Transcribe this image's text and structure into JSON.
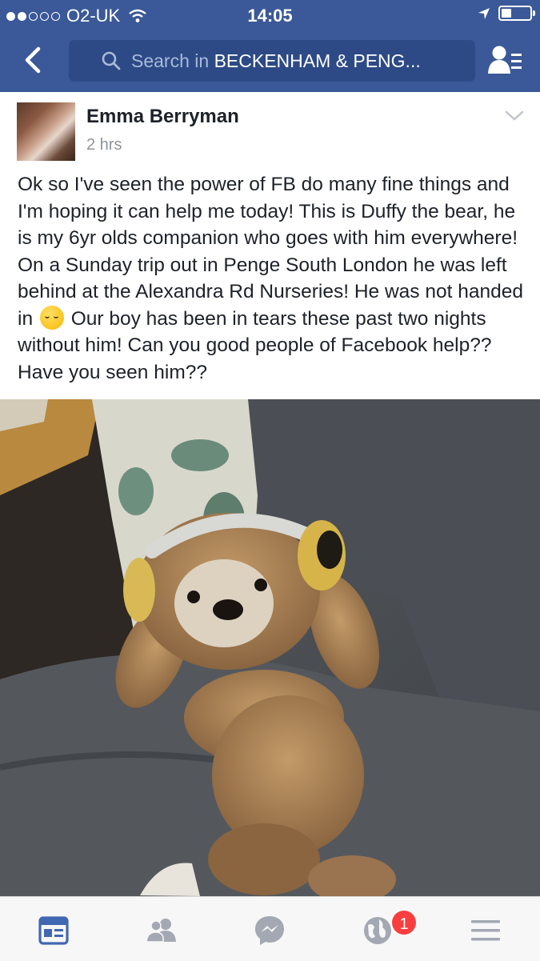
{
  "status_bar": {
    "carrier": "O2-UK",
    "time": "14:05",
    "battery_fraction": 0.35
  },
  "nav": {
    "search_prefix": "Search in ",
    "search_group": "BECKENHAM & PENG..."
  },
  "post": {
    "author": "Emma Berryman",
    "timestamp": "2 hrs",
    "text_before_emoji": "Ok so I've seen the power of FB do many fine things and I'm hoping it can help me today! This is Duffy the bear, he is my 6yr olds companion who goes with him everywhere! On a Sunday trip out in Penge South London he was left behind at the Alexandra Rd Nurseries! He was not handed in",
    "emoji": "pensive-face",
    "text_after_emoji": " Our boy has been in tears these past two nights without him! Can you good people of Facebook help?? Have you seen him??"
  },
  "tab_bar": {
    "tabs": [
      "news-feed-icon",
      "friends-icon",
      "messenger-icon",
      "notifications-globe-icon",
      "menu-icon"
    ],
    "notification_count": "1"
  },
  "colors": {
    "brand": "#3b5998",
    "search_bg": "#2d4a86",
    "active_tab": "#4267b2",
    "inactive_tab": "#a3a8b3",
    "badge": "#fa3e3e"
  }
}
